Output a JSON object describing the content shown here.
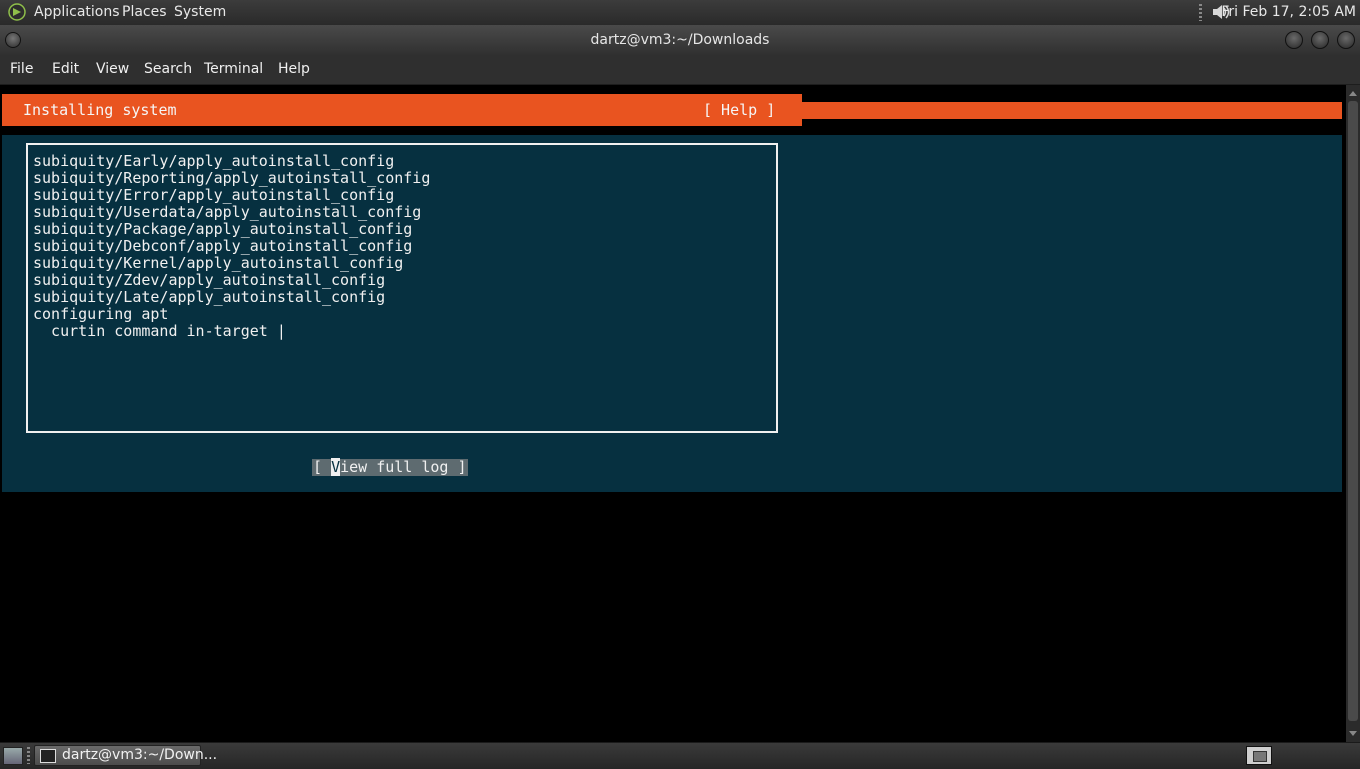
{
  "top_panel": {
    "menus": [
      "Applications",
      "Places",
      "System"
    ],
    "clock": "Fri Feb 17,  2:05 AM",
    "icons": {
      "logo": "distro-logo-icon",
      "volume": "volume-icon"
    }
  },
  "window": {
    "title": "dartz@vm3:~/Downloads",
    "menu": [
      "File",
      "Edit",
      "View",
      "Search",
      "Terminal",
      "Help"
    ]
  },
  "installer": {
    "header_title": "Installing system",
    "help_label": "[ Help ]",
    "log_lines": [
      "subiquity/Early/apply_autoinstall_config",
      "subiquity/Reporting/apply_autoinstall_config",
      "subiquity/Error/apply_autoinstall_config",
      "subiquity/Userdata/apply_autoinstall_config",
      "subiquity/Package/apply_autoinstall_config",
      "subiquity/Debconf/apply_autoinstall_config",
      "subiquity/Kernel/apply_autoinstall_config",
      "subiquity/Zdev/apply_autoinstall_config",
      "subiquity/Late/apply_autoinstall_config",
      "configuring apt",
      "  curtin command in-target |"
    ],
    "view_log": {
      "prefix": "[ ",
      "cursor_char": "V",
      "rest": "iew full log ]"
    },
    "colors": {
      "orange": "#e95420",
      "background": "#063040"
    }
  },
  "taskbar": {
    "task_label": "dartz@vm3:~/Down..."
  }
}
